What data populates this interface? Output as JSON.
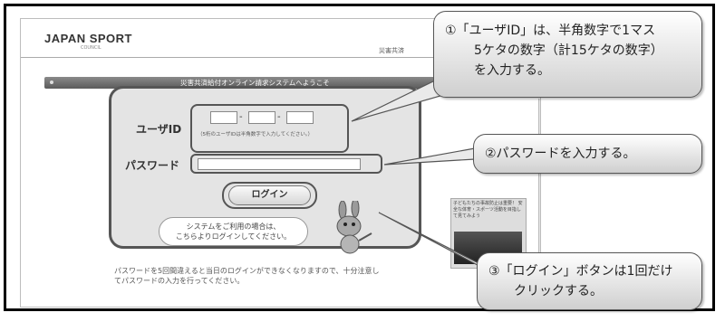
{
  "site": {
    "logo": "JAPAN SPORT",
    "logo_sub": "COUNCIL",
    "header_right": "災害共済"
  },
  "welcome": {
    "text": "災害共済給付オンライン請求システムへようこそ"
  },
  "login": {
    "user_id_label": "ユーザID",
    "dash": "-",
    "user_id_hint": "（5桁のユーザIDは半角数字で入力してください。）",
    "password_label": "パスワード",
    "button_label": "ログイン",
    "note_line1": "システムをご利用の場合は、",
    "note_line2": "こちらよりログインしてください。"
  },
  "footer": {
    "line1": "パスワードを5回間違えると当日のログインができなくなりますので、十分注意し",
    "line2": "てパスワードの入力を行ってください。"
  },
  "side_ad": {
    "text": "子どもたちの事故防止は重要！ 安全な体育・スポーツ活動を目指して見てみよう"
  },
  "callouts": {
    "c1_line1": "①「ユーザID」は、半角数字で1マス",
    "c1_line2": "5ケタの数字（計15ケタの数字）",
    "c1_line3": "を入力する。",
    "c2": "②パスワードを入力する。",
    "c3_line1": "③「ログイン」ボタンは1回だけ",
    "c3_line2": "クリックする。"
  },
  "colors": {
    "frame": "#000000",
    "panel": "#e4e4e4",
    "outline": "#555555",
    "bar": "#6b6b6b"
  }
}
